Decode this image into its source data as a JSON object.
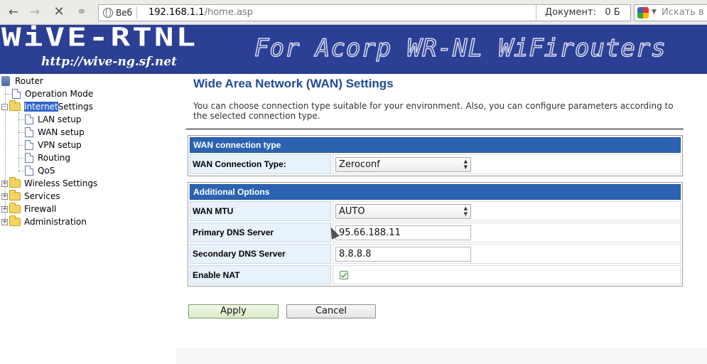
{
  "browser": {
    "site_label": "Веб",
    "url_host": "192.168.1.1",
    "url_path": "/home.asp",
    "doc_label": "Документ:",
    "doc_size": "0 Б",
    "search_placeholder": "Искать в"
  },
  "banner": {
    "brand": "WiVE-RTNL",
    "url": "http://wive-ng.sf.net",
    "slogan": "For Acorp WR-NL WiFirouters"
  },
  "tree": {
    "root": "Router",
    "items": [
      {
        "label": "Operation Mode",
        "type": "page"
      },
      {
        "label_highlight": "Internet",
        "label_rest": " Settings",
        "type": "folder-open"
      },
      {
        "label": "LAN setup",
        "type": "page"
      },
      {
        "label": "WAN setup",
        "type": "page"
      },
      {
        "label": "VPN setup",
        "type": "page"
      },
      {
        "label": "Routing",
        "type": "page"
      },
      {
        "label": "QoS",
        "type": "page"
      },
      {
        "label": "Wireless Settings",
        "type": "folder"
      },
      {
        "label": "Services",
        "type": "folder"
      },
      {
        "label": "Firewall",
        "type": "folder"
      },
      {
        "label": "Administration",
        "type": "folder"
      }
    ]
  },
  "main": {
    "title": "Wide Area Network (WAN) Settings",
    "description": "You can choose connection type suitable for your environment. Also, you can configure parameters according to the selected connection type.",
    "section1": {
      "header": "WAN connection type",
      "type_label": "WAN Connection Type:",
      "type_value": "Zeroconf"
    },
    "section2": {
      "header": "Additional Options",
      "mtu_label": "WAN MTU",
      "mtu_value": "AUTO",
      "dns1_label": "Primary DNS Server",
      "dns1_value": "95.66.188.11",
      "dns2_label": "Secondary DNS Server",
      "dns2_value": "8.8.8.8",
      "nat_label": "Enable NAT",
      "nat_checked": true
    },
    "apply_label": "Apply",
    "cancel_label": "Cancel"
  },
  "colors": {
    "banner": "#2b3f95",
    "section_header": "#2b63b1",
    "title": "#1e4a99",
    "label_bg": "#e8f2fb"
  }
}
